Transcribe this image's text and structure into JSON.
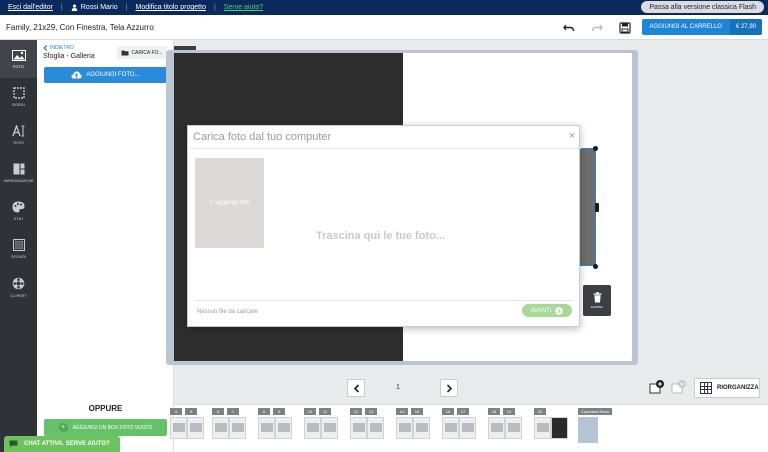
{
  "topbar": {
    "exit": "Esci dall'editor",
    "user": "Rossi Mario",
    "edit_title": "Modifica titolo progetto",
    "help": "Serve aiuto?",
    "flash_btn": "Passa alla versione classica Flash"
  },
  "project": {
    "title": "Family, 21x29, Con Finestra, Tela Azzurro"
  },
  "cart": {
    "label": "AGGIUNGI AL CARRELLO",
    "price": "€ 27,90"
  },
  "sidebar": {
    "items": [
      {
        "label": "FOTO",
        "icon": "image-icon"
      },
      {
        "label": "BORDI",
        "icon": "border-icon"
      },
      {
        "label": "TESTI",
        "icon": "text-icon"
      },
      {
        "label": "IMPAGINAZIONI",
        "icon": "layout-icon"
      },
      {
        "label": "STILI",
        "icon": "palette-icon"
      },
      {
        "label": "SFONDI",
        "icon": "background-icon"
      },
      {
        "label": "CLIPART",
        "icon": "clipart-icon"
      }
    ]
  },
  "panel": {
    "back": "INDIETRO",
    "title": "Sfoglia - Galleria",
    "load_btn": "CARICA FO...",
    "add_photos": "AGGIUNGI FOTO...",
    "or": "OPPURE",
    "empty_box": "AGGIUNGI UN BOX FOTO VUOTO"
  },
  "chat": {
    "label": "CHAT ATTIVA. SERVE AIUTO?"
  },
  "modal": {
    "title": "Carica foto dal tuo computer",
    "add_photo": "+ aggiungi foto",
    "drop_hint": "Trascina qui le tue foto...",
    "no_files": "Nessun file da caricare",
    "next": "AVANTI"
  },
  "canvas": {
    "trash_label": "ELIMINA"
  },
  "pager": {
    "page": "1"
  },
  "reorganize": {
    "label": "RIORGANIZZA"
  },
  "thumbnails": {
    "spreads": [
      {
        "left": "4",
        "right": "5"
      },
      {
        "left": "6",
        "right": "7"
      },
      {
        "left": "8",
        "right": "9"
      },
      {
        "left": "10",
        "right": "11"
      },
      {
        "left": "12",
        "right": "13"
      },
      {
        "left": "14",
        "right": "15"
      },
      {
        "left": "16",
        "right": "17"
      },
      {
        "left": "18",
        "right": "19"
      },
      {
        "left": "20",
        "right": ""
      }
    ],
    "cover_label": "Copertina Retro"
  }
}
